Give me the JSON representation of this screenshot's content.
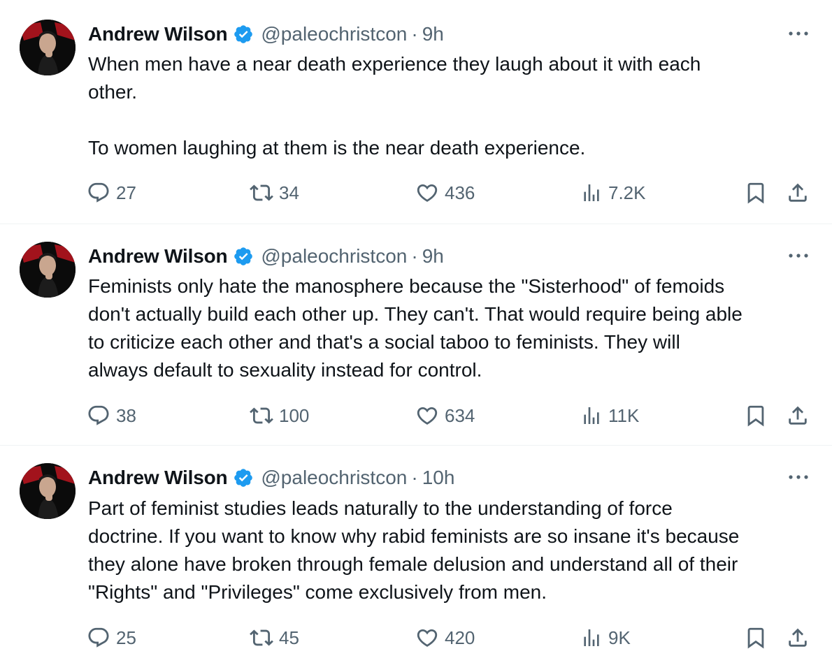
{
  "colors": {
    "verified_badge": "#1d9bf0",
    "secondary_text": "#536471",
    "divider": "#eff3f4"
  },
  "icons": {
    "reply": "speech-bubble-icon",
    "retweet": "retweet-arrows-icon",
    "like": "heart-icon",
    "views": "bar-chart-icon",
    "bookmark": "bookmark-icon",
    "share": "upload-share-icon",
    "more": "ellipsis-icon",
    "verified": "verified-badge-icon"
  },
  "tweets": [
    {
      "author": {
        "name": "Andrew Wilson",
        "handle": "@paleochristcon"
      },
      "separator": "·",
      "time": "9h",
      "text": "When men have a near death experience they laugh about it with each\nother.\n\nTo women laughing at them is the near death experience.",
      "stats": {
        "replies": "27",
        "retweets": "34",
        "likes": "436",
        "views": "7.2K"
      }
    },
    {
      "author": {
        "name": "Andrew Wilson",
        "handle": "@paleochristcon"
      },
      "separator": "·",
      "time": "9h",
      "text": "Feminists only hate the manosphere because the \"Sisterhood\" of femoids\ndon't actually build each other up. They can't. That would require being able\nto criticize each other and that's a social taboo to feminists. They will\nalways default to sexuality instead for control.",
      "stats": {
        "replies": "38",
        "retweets": "100",
        "likes": "634",
        "views": "11K"
      }
    },
    {
      "author": {
        "name": "Andrew Wilson",
        "handle": "@paleochristcon"
      },
      "separator": "·",
      "time": "10h",
      "text": "Part of feminist studies leads naturally to the understanding of force\ndoctrine. If you want to know why rabid feminists are so insane it's because\nthey alone have broken through female delusion and understand all of their\n\"Rights\" and \"Privileges\" come exclusively from men.",
      "stats": {
        "replies": "25",
        "retweets": "45",
        "likes": "420",
        "views": "9K"
      }
    }
  ]
}
